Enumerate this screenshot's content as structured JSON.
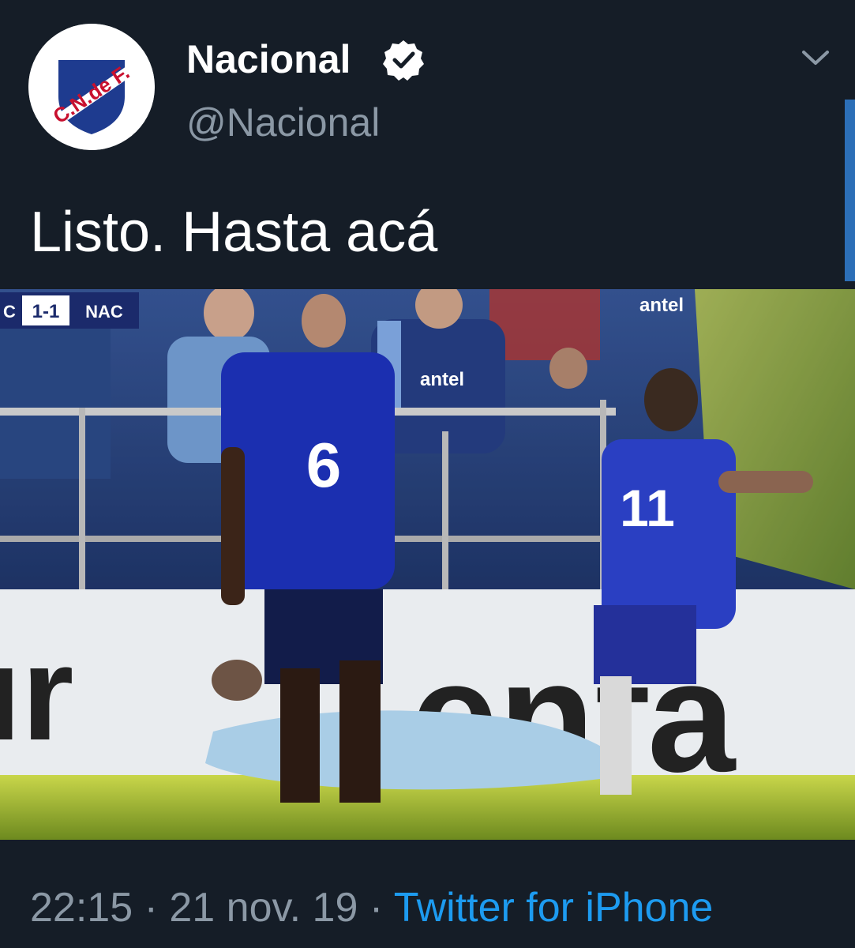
{
  "account": {
    "name": "Nacional",
    "handle": "@Nacional",
    "verified": true,
    "avatar_text": "C.N.de F."
  },
  "tweet": {
    "text": "Listo. Hasta acá"
  },
  "media": {
    "scoreboard": {
      "left_team": "C",
      "score": "1-1",
      "right_team": "NAC"
    },
    "player_left_number": "6",
    "player_right_number": "11",
    "sponsor_shirt": "antel",
    "sponsor_top": "antel"
  },
  "meta": {
    "time": "22:15",
    "date": "21 nov. 19",
    "separator": "·",
    "source": "Twitter for iPhone"
  },
  "icons": {
    "verified": "verified-badge-icon",
    "menu": "chevron-down-icon"
  },
  "colors": {
    "background": "#151d27",
    "secondary_text": "#8b98a5",
    "link": "#1d9bf0",
    "club_blue": "#1e3b8f",
    "club_red": "#c8102e"
  }
}
